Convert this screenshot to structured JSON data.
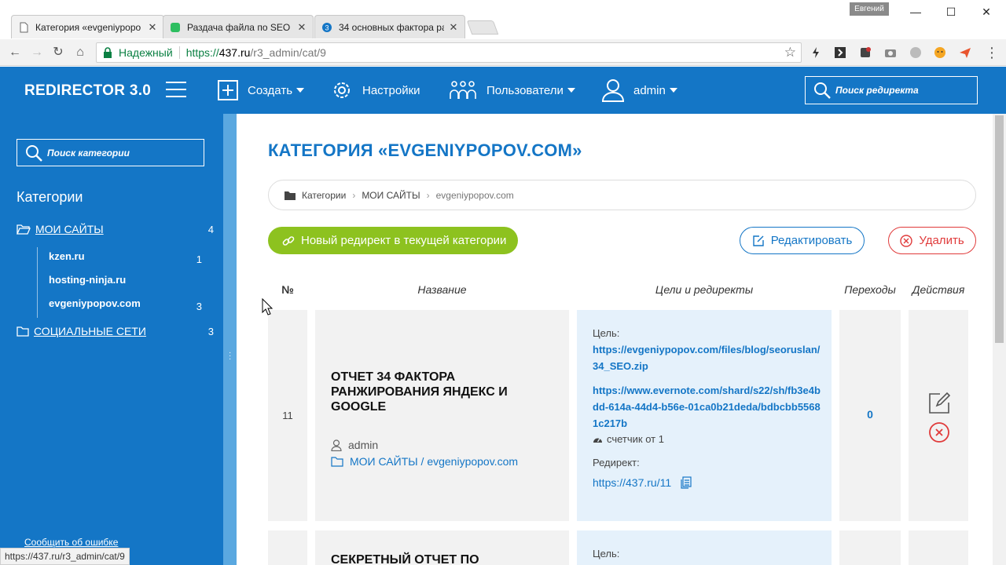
{
  "browser": {
    "tabs": [
      {
        "title": "Категория «evgeniypopo"
      },
      {
        "title": "Раздача файла по SEO"
      },
      {
        "title": "34 основных фактора ра"
      }
    ],
    "profile_name": "Евгений",
    "secure_label": "Надежный",
    "url_prefix": "https://",
    "url_host": "437.ru",
    "url_path": "/r3_admin/cat/9",
    "status_url": "https://437.ru/r3_admin/cat/9"
  },
  "header": {
    "brand": "REDIRECTOR 3.0",
    "create_label": "Создать",
    "settings_label": "Настройки",
    "users_label": "Пользователи",
    "user_label": "admin",
    "search_placeholder": "Поиск редиректа"
  },
  "sidebar": {
    "search_placeholder": "Поиск категории",
    "heading": "Категории",
    "categories": [
      {
        "label": "МОИ САЙТЫ",
        "count": "4"
      },
      {
        "label": "СОЦИАЛЬНЫЕ СЕТИ",
        "count": "3"
      }
    ],
    "subcategories": [
      {
        "label": "kzen.ru",
        "count": "1"
      },
      {
        "label": "hosting-ninja.ru",
        "count": ""
      },
      {
        "label": "evgeniypopov.com",
        "count": "3"
      }
    ],
    "report_link": "Сообщить об ошибке"
  },
  "main": {
    "title": "КАТЕГОРИЯ «EVGENIYPOPOV.COM»",
    "breadcrumb": [
      "Категории",
      "МОИ САЙТЫ",
      "evgeniypopov.com"
    ],
    "new_redirect_label": "Новый редирект в текущей категории",
    "edit_label": "Редактировать",
    "delete_label": "Удалить",
    "columns": [
      "№",
      "Название",
      "Цели и редиректы",
      "Переходы",
      "Действия"
    ],
    "rows": [
      {
        "num": "11",
        "name": "ОТЧЕТ 34 ФАКТОРА РАНЖИРОВАНИЯ ЯНДЕКС И GOOGLE",
        "user": "admin",
        "category_path": "МОИ САЙТЫ / evgeniypopov.com",
        "target_label": "Цель:",
        "targets": [
          "https://evgeniypopov.com/files/blog/seoruslan/34_SEO.zip",
          "https://www.evernote.com/shard/s22/sh/fb3e4bdd-614a-44d4-b56e-01ca0b21deda/bdbcbb55681c217b"
        ],
        "counter": "счетчик от 1",
        "redirect_label": "Редирект:",
        "redirect_url": "https://437.ru/11",
        "visits": "0"
      },
      {
        "name": "СЕКРЕТНЫЙ ОТЧЕТ ПО",
        "target_label": "Цель:"
      }
    ]
  },
  "colors": {
    "primary": "#1476c6",
    "green": "#8dc21f",
    "red": "#e03a3a",
    "cell_gray": "#f2f2f2",
    "cell_blue": "#e5f1fb"
  }
}
